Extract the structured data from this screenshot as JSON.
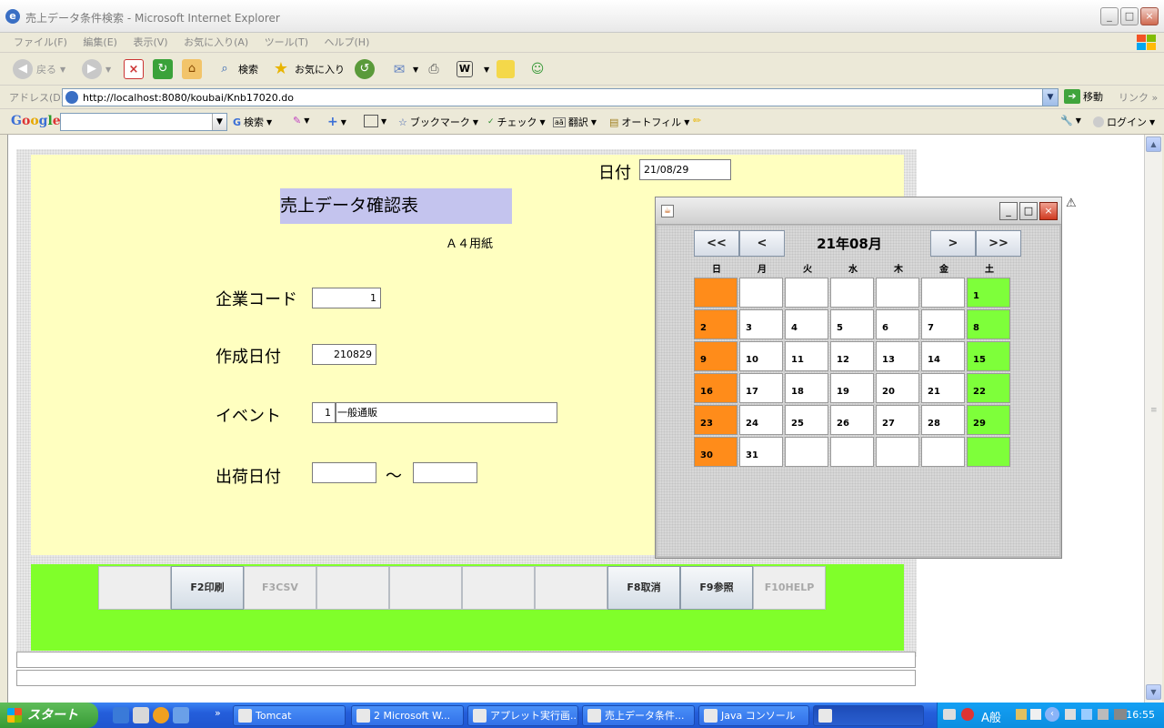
{
  "window": {
    "title": "売上データ条件検索 - Microsoft Internet Explorer"
  },
  "menu": [
    "ファイル(F)",
    "編集(E)",
    "表示(V)",
    "お気に入り(A)",
    "ツール(T)",
    "ヘルプ(H)"
  ],
  "toolbar": {
    "back": "戻る",
    "search": "検索",
    "favorites": "お気に入り"
  },
  "address": {
    "label": "アドレス(D)",
    "url": "http://localhost:8080/koubai/Knb17020.do",
    "go": "移動",
    "links": "リンク"
  },
  "google": {
    "logo": "Google",
    "search": "検索",
    "bookmarks": "ブックマーク",
    "check": "チェック",
    "translate": "翻訳",
    "autofill": "オートフィル",
    "login": "ログイン"
  },
  "form": {
    "date_label": "日付",
    "date_value": "21/08/29",
    "report_title": "売上データ確認表",
    "paper": "Ａ４用紙",
    "company_code_label": "企業コード",
    "company_code_value": "1",
    "created_date_label": "作成日付",
    "created_date_value": "210829",
    "event_label": "イベント",
    "event_code": "1",
    "event_name": "一般通販",
    "ship_date_label": "出荷日付",
    "ship_date_from": "",
    "ship_date_to": "",
    "range_sep": "～"
  },
  "fkeys": [
    {
      "label": "",
      "enabled": false
    },
    {
      "label": "F2印刷",
      "enabled": true
    },
    {
      "label": "F3CSV",
      "enabled": false
    },
    {
      "label": "",
      "enabled": false
    },
    {
      "label": "",
      "enabled": false
    },
    {
      "label": "",
      "enabled": false
    },
    {
      "label": "",
      "enabled": false
    },
    {
      "label": "F8取消",
      "enabled": true
    },
    {
      "label": "F9参照",
      "enabled": true
    },
    {
      "label": "F10HELP",
      "enabled": false
    }
  ],
  "calendar": {
    "month_label": "21年08月",
    "prev_year": "<<",
    "prev_month": "<",
    "next_month": ">",
    "next_year": ">>",
    "weekdays": [
      "日",
      "月",
      "火",
      "水",
      "木",
      "金",
      "土"
    ],
    "weeks": [
      [
        "",
        "",
        "",
        "",
        "",
        "",
        "1"
      ],
      [
        "2",
        "3",
        "4",
        "5",
        "6",
        "7",
        "8"
      ],
      [
        "9",
        "10",
        "11",
        "12",
        "13",
        "14",
        "15"
      ],
      [
        "16",
        "17",
        "18",
        "19",
        "20",
        "21",
        "22"
      ],
      [
        "23",
        "24",
        "25",
        "26",
        "27",
        "28",
        "29"
      ],
      [
        "30",
        "31",
        "",
        "",
        "",
        "",
        ""
      ]
    ],
    "sunday_color": "#ff8c1a",
    "saturday_color": "#7eff3a"
  },
  "taskbar": {
    "start": "スタート",
    "tasks": [
      "Tomcat",
      "2 Microsoft W...",
      "アプレット実行画...",
      "売上データ条件...",
      "Java コンソール",
      ""
    ],
    "ime": "A般",
    "clock": "16:55"
  }
}
